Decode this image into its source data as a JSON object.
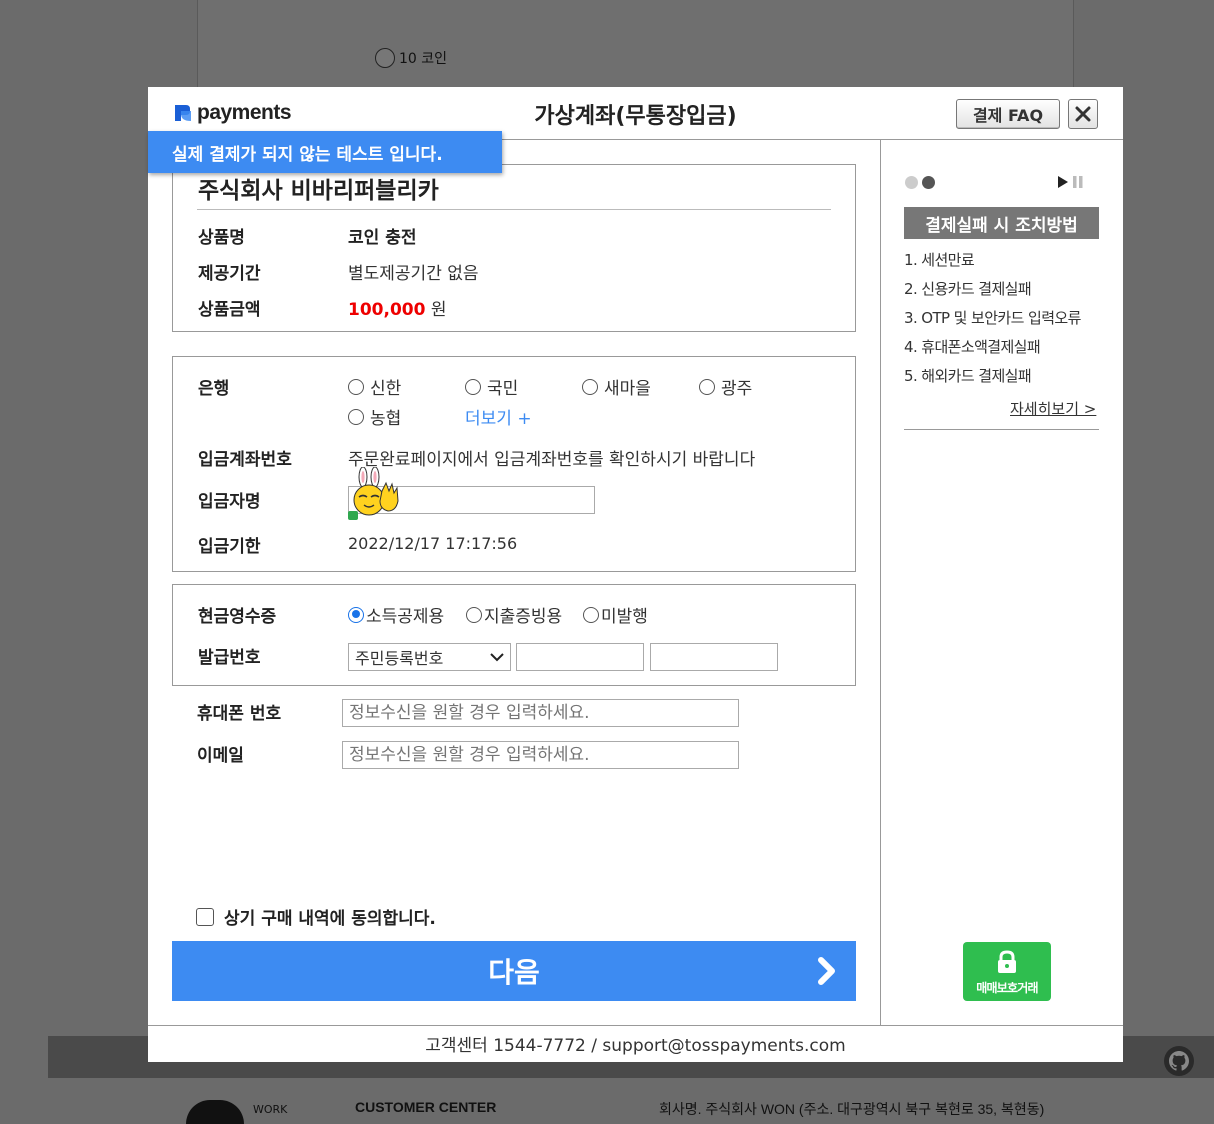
{
  "background": {
    "radio_label": "10 코인",
    "customer_center": "CUSTOMER CENTER",
    "company_address": "회사명. 주식회사 WON (주소. 대구광역시 북구 복현로 35, 복현동)",
    "logo_text": "WORK"
  },
  "modal": {
    "brand": "payments",
    "title": "가상계좌(무통장입금)",
    "faq_label": "결제 FAQ",
    "test_banner": "실제 결제가 되지 않는 테스트 입니다.",
    "footer": "고객센터 1544-7772 / support@tosspayments.com"
  },
  "product": {
    "company": "주식회사 비바리퍼블리카",
    "name_label": "상품명",
    "name_value": "코인 충전",
    "period_label": "제공기간",
    "period_value": "별도제공기간 없음",
    "price_label": "상품금액",
    "price_value": "100,000",
    "price_unit": "원"
  },
  "deposit": {
    "bank_label": "은행",
    "banks": [
      "신한",
      "국민",
      "새마을",
      "광주",
      "농협"
    ],
    "more_label": "더보기 +",
    "account_label": "입금계좌번호",
    "account_value": "주문완료페이지에서 입금계좌번호를 확인하시기 바랍니다",
    "depositor_label": "입금자명",
    "depositor_value": "",
    "deadline_label": "입금기한",
    "deadline_value": "2022/12/17 17:17:56"
  },
  "receipt": {
    "label": "현금영수증",
    "options": [
      "소득공제용",
      "지출증빙용",
      "미발행"
    ],
    "selected": "소득공제용",
    "issue_label": "발급번호",
    "issue_type": "주민등록번호"
  },
  "contact": {
    "phone_label": "휴대폰 번호",
    "phone_placeholder": "정보수신을 원할 경우 입력하세요.",
    "email_label": "이메일",
    "email_placeholder": "정보수신을 원할 경우 입력하세요."
  },
  "agree_label": "상기 구매 내역에 동의합니다.",
  "next_label": "다음",
  "sidebar": {
    "fail_title": "결제실패 시 조치방법",
    "fail_items": [
      "1. 세션만료",
      "2. 신용카드 결제실패",
      "3. OTP 및 보안카드 입력오류",
      "4. 휴대폰소액결제실패",
      "5. 해외카드 결제실패"
    ],
    "detail_link": "자세히보기 >",
    "escrow_label": "매매보호거래"
  },
  "colors": {
    "accent": "#3d8bf2",
    "price": "#ee0000",
    "escrow": "#2fbe4f",
    "overlay": "#6b6b6b"
  }
}
